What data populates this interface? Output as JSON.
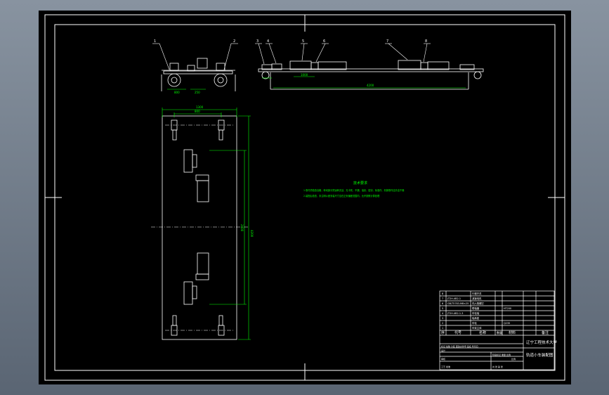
{
  "drawing": {
    "tech_requirements": {
      "title": "技术要求",
      "line1": "1.零件须检查合格，转动部分须运转灵活、无卡死、不漏、油封、密封、标准件、机械零件应清洁干燥",
      "line2": "2.装配后检查，未注明公差安装尺寸应在正负偏差范围内，允许按照计算处理"
    },
    "side_view_labels": [
      "1",
      "2",
      "3",
      "4",
      "5",
      "6",
      "7",
      "8"
    ],
    "dimensions": {
      "side_left_width": "800",
      "side_left_small": "250",
      "side_right_small": "1000",
      "side_right_overall": "4200",
      "plan_top_overall": "1300",
      "plan_top_inner": "800",
      "plan_right_overall": "4200",
      "plan_right_inner": "2400"
    }
  },
  "title_block": {
    "school": "辽宁工程技术大学",
    "drawing_title": "轨道小车装配图",
    "scale_label": "比例",
    "parts_table": {
      "headers": [
        "序",
        "代号",
        "名称",
        "数量",
        "材料",
        "备注"
      ],
      "rows": [
        {
          "no": "8",
          "code": "",
          "name": "行程开关",
          "qty": "",
          "material": "",
          "note": ""
        },
        {
          "no": "7",
          "code": "JT2H-4B2-1",
          "name": "减速电机",
          "qty": "",
          "material": "",
          "note": ""
        },
        {
          "no": "6",
          "code": "GB/T5783-M8×25",
          "name": "内六角螺钉",
          "qty": "",
          "material": "",
          "note": ""
        },
        {
          "no": "5",
          "code": "",
          "name": "联轴器",
          "qty": "",
          "material": "HT200",
          "note": ""
        },
        {
          "no": "4",
          "code": "JT2H-4B2-1-3",
          "name": "车轮轴",
          "qty": "",
          "material": "",
          "note": ""
        },
        {
          "no": "3",
          "code": "",
          "name": "轴承座",
          "qty": "",
          "material": "",
          "note": ""
        },
        {
          "no": "2",
          "code": "",
          "name": "车轮",
          "qty": "",
          "material": "Q235",
          "note": ""
        },
        {
          "no": "1",
          "code": "",
          "name": "车架主体",
          "qty": "",
          "material": "",
          "note": ""
        }
      ]
    },
    "sign_rows": [
      "标记 处数 分区 更改文件号 签名 年月日",
      "设计",
      "审核",
      "工艺 批准"
    ],
    "stage_label": "阶段标记 重量 比例",
    "sheet_label": "共 张 第 张"
  },
  "colors": {
    "frame": "#ffffff",
    "line": "#ffffff",
    "dimension": "#00ff00",
    "text": "#00ff00",
    "background": "#000000"
  }
}
